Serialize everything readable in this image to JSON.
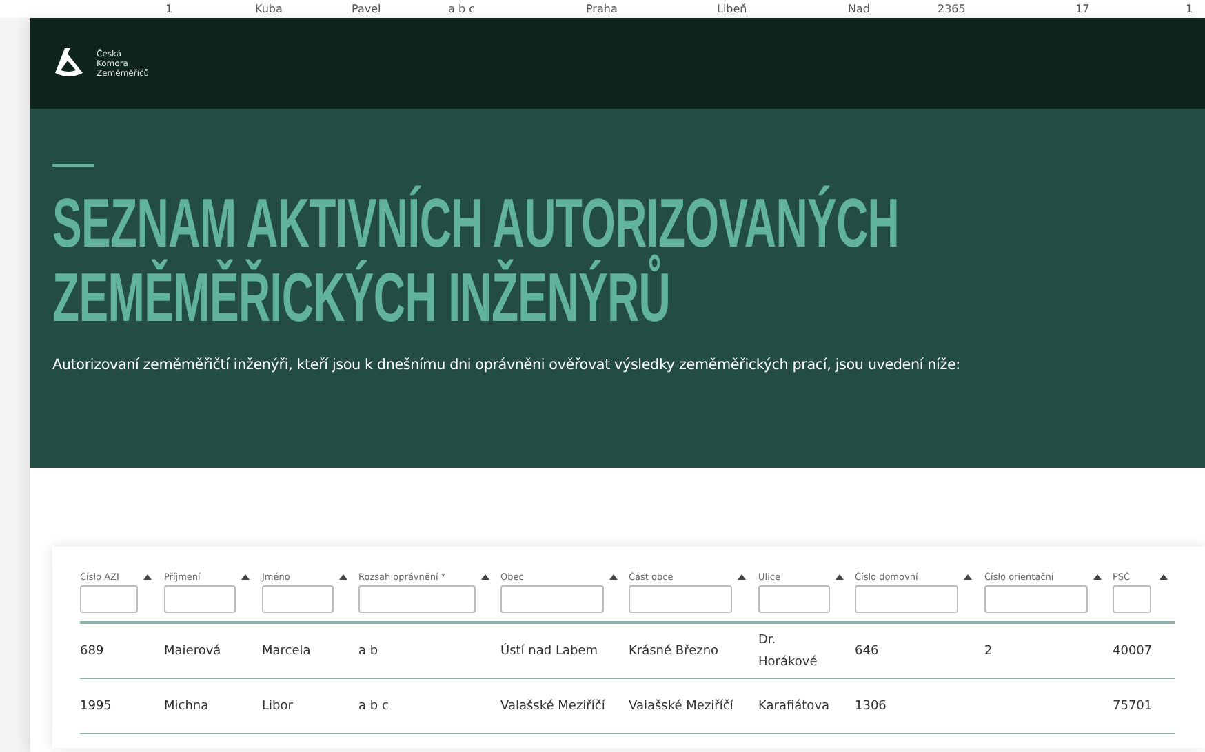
{
  "background_row": [
    "1",
    "Kuba",
    "Pavel",
    "a b c",
    "Praha",
    "Libeň",
    "Nad",
    "2365",
    "17",
    "1"
  ],
  "logo": {
    "lines": [
      "Česká",
      "Komora",
      "Zeměměřičů"
    ]
  },
  "hero": {
    "title": "SEZNAM AKTIVNÍCH AUTORIZOVANÝCH ZEMĚMĚŘICKÝCH INŽENÝRŮ",
    "subtitle": "Autorizovaní zeměměřičtí inženýři, kteří jsou k dnešnímu dni oprávněni ověřovat výsledky zeměměřických prací, jsou uvedení níže:"
  },
  "table": {
    "columns": [
      {
        "label": "Číslo AZI"
      },
      {
        "label": "Příjmení"
      },
      {
        "label": "Jméno"
      },
      {
        "label": "Rozsah oprávnění *"
      },
      {
        "label": "Obec"
      },
      {
        "label": "Část obce"
      },
      {
        "label": "Ulice"
      },
      {
        "label": "Číslo domovní"
      },
      {
        "label": "Číslo orientační"
      },
      {
        "label": "PSČ"
      }
    ],
    "rows": [
      [
        "689",
        "Maierová",
        "Marcela",
        "a b",
        "Ústí nad Labem",
        "Krásné Březno",
        "Dr. Horákové",
        "646",
        "2",
        "40007"
      ],
      [
        "1995",
        "Michna",
        "Libor",
        "a b c",
        "Valašské Meziříčí",
        "Valašské Meziříčí",
        "Karafiátova",
        "1306",
        "",
        "75701"
      ]
    ]
  }
}
